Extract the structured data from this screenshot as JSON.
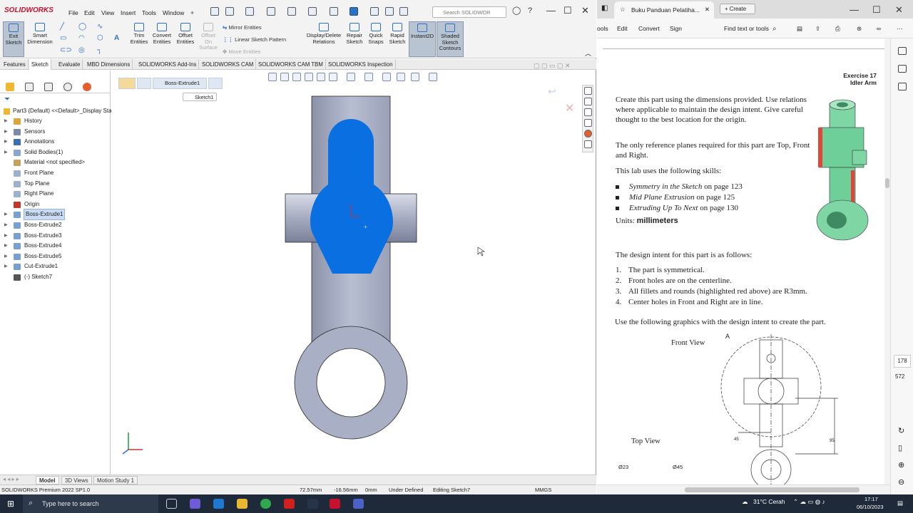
{
  "solidworks": {
    "logo": "SOLIDWORKS",
    "menu": [
      "File",
      "Edit",
      "View",
      "Insert",
      "Tools",
      "Window"
    ],
    "search_placeholder": "Search SOLIDWOR",
    "command_buttons": [
      {
        "label": "Exit\nSketch",
        "state": "active"
      },
      {
        "label": "Smart\nDimension"
      },
      {
        "label": "Trim\nEntities"
      },
      {
        "label": "Convert\nEntities"
      },
      {
        "label": "Offset\nEntities"
      },
      {
        "label": "Offset\nOn\nSurface",
        "state": "disabled"
      },
      {
        "label": "Display/Delete\nRelations"
      },
      {
        "label": "Repair\nSketch"
      },
      {
        "label": "Quick\nSnaps"
      },
      {
        "label": "Rapid\nSketch"
      },
      {
        "label": "Instant2D",
        "state": "active"
      },
      {
        "label": "Shaded\nSketch\nContours",
        "state": "active"
      }
    ],
    "mirror_entities": "Mirror Entities",
    "linear_pattern": "Linear Sketch Pattern",
    "move_entities": "Move Entities",
    "tabs": [
      "Features",
      "Sketch",
      "Evaluate",
      "MBD Dimensions",
      "SOLIDWORKS Add-Ins",
      "SOLIDWORKS CAM",
      "SOLIDWORKS CAM TBM",
      "SOLIDWORKS Inspection"
    ],
    "active_tab": "Sketch",
    "tree_root": "Part3 (Default) <<Default>_Display Sta",
    "tree": [
      {
        "label": "History",
        "icon": "history-icon",
        "color": "#d9a640"
      },
      {
        "label": "Sensors",
        "icon": "sensor-icon",
        "color": "#7a8aa8"
      },
      {
        "label": "Annotations",
        "icon": "annotation-icon",
        "color": "#3d6fb0"
      },
      {
        "label": "Solid Bodies(1)",
        "icon": "solid-body-icon",
        "color": "#8aa7c9"
      },
      {
        "label": "Material <not specified>",
        "icon": "material-icon",
        "color": "#c8a060"
      },
      {
        "label": "Front Plane",
        "icon": "plane-icon",
        "color": "#9db0cc"
      },
      {
        "label": "Top Plane",
        "icon": "plane-icon",
        "color": "#9db0cc"
      },
      {
        "label": "Right Plane",
        "icon": "plane-icon",
        "color": "#9db0cc"
      },
      {
        "label": "Origin",
        "icon": "origin-icon",
        "color": "#c0392b"
      },
      {
        "label": "Boss-Extrude1",
        "icon": "extrude-icon",
        "color": "#7aa0d0",
        "selected": true
      },
      {
        "label": "Boss-Extrude2",
        "icon": "extrude-icon",
        "color": "#7aa0d0"
      },
      {
        "label": "Boss-Extrude3",
        "icon": "extrude-icon",
        "color": "#7aa0d0"
      },
      {
        "label": "Boss-Extrude4",
        "icon": "extrude-icon",
        "color": "#7aa0d0"
      },
      {
        "label": "Boss-Extrude5",
        "icon": "extrude-icon",
        "color": "#7aa0d0"
      },
      {
        "label": "Cut-Extrude1",
        "icon": "cut-icon",
        "color": "#7aa0d0"
      },
      {
        "label": "(-) Sketch7",
        "icon": "sketch-icon",
        "color": "#555"
      }
    ],
    "breadcrumb": "Boss-Extrude1",
    "sketch_tag": "Sketch1",
    "bottom_tabs": [
      "Model",
      "3D Views",
      "Motion Study 1"
    ],
    "status": {
      "product": "SOLIDWORKS Premium 2022 SP1.0",
      "x": "72.57mm",
      "y": "-16.56mm",
      "z": "0mm",
      "state": "Under Defined",
      "editing": "Editing Sketch7",
      "units": "MMGS"
    },
    "part_colors": {
      "body": "#a9b0c5",
      "sketch": "#0a6fe0",
      "edge": "#2a2a2a"
    }
  },
  "pdf": {
    "tab_title": "Buku Panduan Pelatiha...",
    "new_tab": "Create",
    "toolbar": [
      "ools",
      "Edit",
      "Convert",
      "Sign"
    ],
    "find": "Find text or tools",
    "exercise": "Exercise 17",
    "exercise_name": "Idler Arm",
    "intro": "Create this part using the dimensions provided. Use relations where applicable to maintain the design intent. Give careful thought to the best location for the origin.",
    "planes": "The only reference planes required for this part are Top, Front and Right.",
    "skills_intro": "This lab uses the following skills:",
    "skills": [
      {
        "name": "Symmetry in the Sketch",
        "page": "on page 123"
      },
      {
        "name": "Mid Plane Extrusion",
        "page": "on page 125"
      },
      {
        "name": "Extruding Up To Next",
        "page": "on page 130"
      }
    ],
    "units_label": "Units:",
    "units_value": "millimeters",
    "intent_intro": "The design intent for this part is as follows:",
    "intent": [
      "The part is symmetrical.",
      "Front holes are on the centerline.",
      "All fillets and rounds (highlighted red above) are R3mm.",
      "Center holes in Front and Right are in line."
    ],
    "graphics_intro": "Use the following graphics with the design intent to create the part.",
    "front_view": "Front View",
    "top_view": "Top View",
    "dims": {
      "d45": "45",
      "d95": "95",
      "dia23": "Ø23",
      "dia45": "Ø45",
      "label_a": "A"
    },
    "page_current": "178",
    "page_total": "572"
  },
  "taskbar": {
    "search": "Type here to search",
    "weather": "31°C  Cerah",
    "time": "17:17",
    "date": "06/10/2023"
  }
}
